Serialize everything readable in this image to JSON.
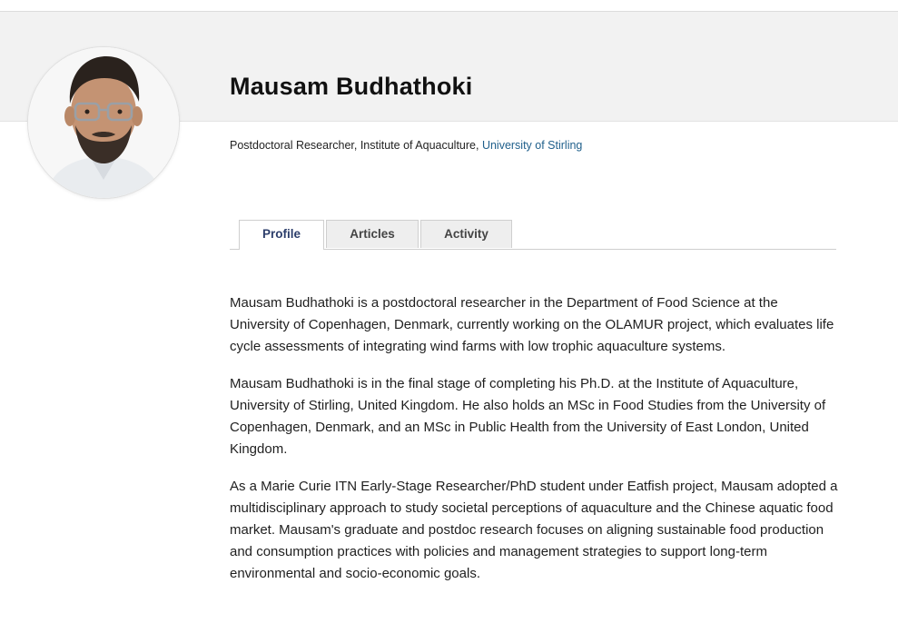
{
  "profile": {
    "name": "Mausam Budhathoki",
    "affiliation_prefix": "Postdoctoral Researcher, Institute of Aquaculture, ",
    "affiliation_link": "University of Stirling",
    "avatar_alt": "Mausam Budhathoki"
  },
  "tabs": [
    {
      "label": "Profile",
      "active": true
    },
    {
      "label": "Articles",
      "active": false
    },
    {
      "label": "Activity",
      "active": false
    }
  ],
  "bio": {
    "paragraphs": [
      "Mausam Budhathoki is a postdoctoral researcher in the Department of Food Science at the University of Copenhagen, Denmark, currently working on the OLAMUR project, which evaluates life cycle assessments of integrating wind farms with low trophic aquaculture systems.",
      "Mausam Budhathoki is in the final stage of completing his Ph.D. at the Institute of Aquaculture, University of Stirling, United Kingdom. He also holds an MSc in Food Studies from the University of Copenhagen, Denmark, and an MSc in Public Health from the University of East London, United Kingdom.",
      "As a Marie Curie ITN Early-Stage Researcher/PhD student under Eatfish project, Mausam adopted a multidisciplinary approach to study societal perceptions of aquaculture and the Chinese aquatic food market. Mausam's graduate and postdoc research focuses on aligning sustainable food production and consumption practices with policies and management strategies to support long-term environmental and socio-economic goals."
    ]
  },
  "colors": {
    "header_band": "#f2f2f2",
    "link": "#1f5f8b",
    "active_tab_text": "#2c3e6b"
  }
}
